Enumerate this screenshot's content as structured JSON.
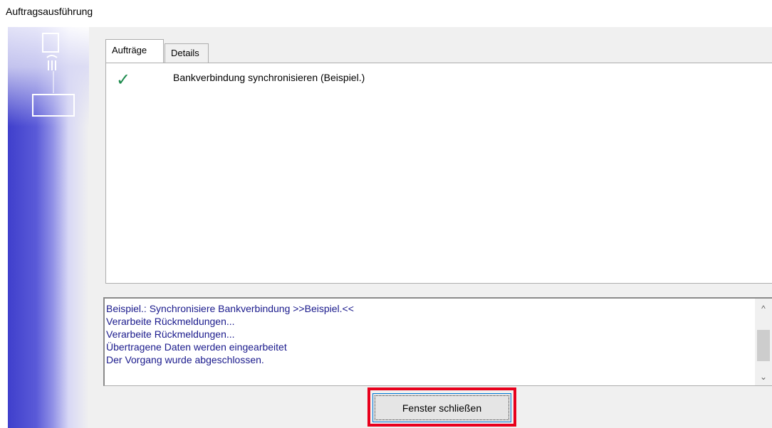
{
  "window": {
    "title": "Auftragsausführung"
  },
  "tabs": [
    {
      "label": "Aufträge",
      "active": true
    },
    {
      "label": "Details",
      "active": false
    }
  ],
  "jobs": [
    {
      "status_icon": "checkmark-icon",
      "label": "Bankverbindung synchronisieren (Beispiel.)"
    }
  ],
  "log": {
    "lines": [
      "Beispiel.: Synchronisiere Bankverbindung >>Beispiel.<<",
      "Verarbeite Rückmeldungen...",
      "Verarbeite Rückmeldungen...",
      "Übertragene Daten werden eingearbeitet",
      "Der Vorgang wurde abgeschlossen."
    ]
  },
  "buttons": {
    "close_label": "Fenster schließen"
  },
  "colors": {
    "highlight": "#e8001c",
    "log_text": "#1a1a8c",
    "check": "#1c8a4c"
  }
}
